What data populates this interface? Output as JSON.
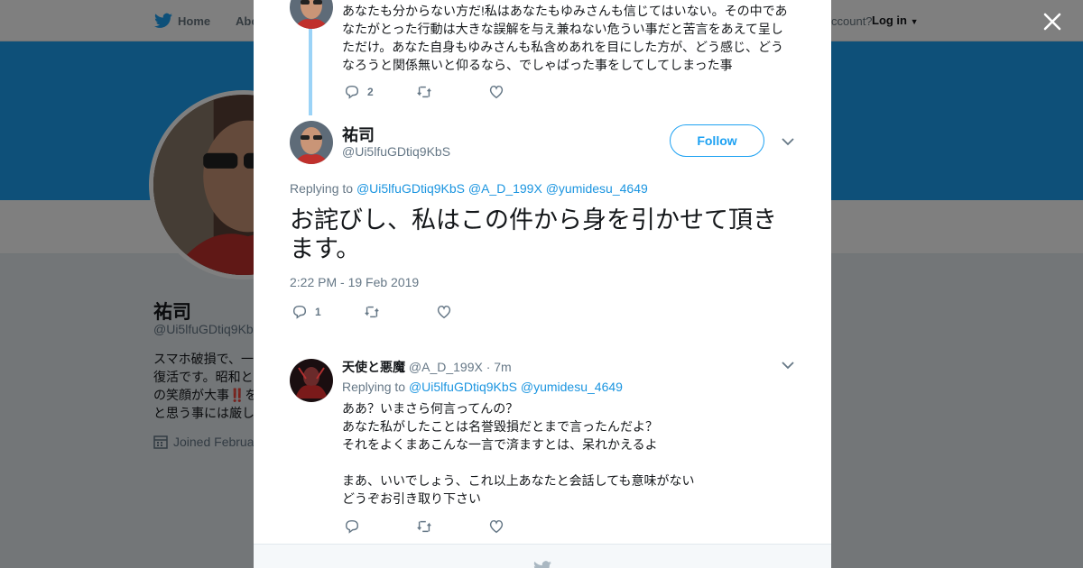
{
  "topnav": {
    "home": "Home",
    "about": "Abo",
    "account_prompt": "ccount?",
    "login": "Log in"
  },
  "profile": {
    "name": "祐司",
    "handle": "@Ui5lfuGDtiq9Kb",
    "bio_lines": [
      "スマホ破損で、一",
      "復活です。昭和と",
      "の笑顔が大事‼️を",
      "と思う事には厳し"
    ],
    "joined": "Joined Februa"
  },
  "thread_parent": {
    "text_lines": [
      "あなたも分からない方だ!私はあなたもゆみさんも信じてはいない。その中であ",
      "なたがとった行動は大きな誤解を与え兼ねない危うい事だと苦言をあえて呈し",
      "ただけ。あなた自身もゆみさんも私含めあれを目にした方が、どう感じ、どう",
      "なろうと関係無いと仰るなら、でしゃばった事をしてしてしまった事"
    ],
    "reply_count": "2"
  },
  "main_tweet": {
    "name": "祐司",
    "handle": "@Ui5lfuGDtiq9KbS",
    "follow_label": "Follow",
    "replying_prefix": "Replying to",
    "replying_to": [
      "@Ui5lfuGDtiq9KbS",
      "@A_D_199X",
      "@yumidesu_4649"
    ],
    "text_line1": "お詫びし、私はこの件から身を引かせて頂き",
    "text_line2": "ます。",
    "timestamp": "2:22 PM - 19 Feb 2019",
    "reply_count": "1"
  },
  "reply_tweet": {
    "name": "天使と悪魔",
    "handle": "@A_D_199X",
    "time": "· 7m",
    "replying_prefix": "Replying to",
    "replying_to": [
      "@Ui5lfuGDtiq9KbS",
      "@yumidesu_4649"
    ],
    "text_lines": [
      "ああ？いまさら何言ってんの？",
      "あなた私がしたことは名誉毀損だとまで言ったんだよ？",
      "それをよくまあこんな一言で済ますとは、呆れかえるよ",
      "",
      "まあ、いいでしょう、これ以上あなたと会話しても意味がない",
      "どうぞお引き取り下さい"
    ]
  },
  "icons": {
    "brand": "twitter-bird-icon",
    "reply": "reply-icon",
    "retweet": "retweet-icon",
    "like": "heart-icon",
    "close": "close-icon",
    "calendar": "calendar-icon"
  },
  "colors": {
    "brand_blue": "#1da1f2",
    "link_blue": "#1b95e0",
    "thread_line": "#9bd3f7",
    "muted": "#657786"
  }
}
